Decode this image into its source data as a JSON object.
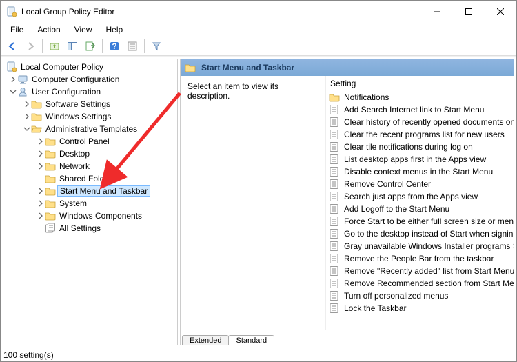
{
  "window": {
    "title": "Local Group Policy Editor"
  },
  "menu": {
    "file": "File",
    "action": "Action",
    "view": "View",
    "help": "Help"
  },
  "tree": {
    "root": "Local Computer Policy",
    "cc": "Computer Configuration",
    "uc": "User Configuration",
    "ss": "Software Settings",
    "ws": "Windows Settings",
    "at": "Administrative Templates",
    "cp": "Control Panel",
    "dk": "Desktop",
    "nw": "Network",
    "sf": "Shared Folders",
    "sm": "Start Menu and Taskbar",
    "sy": "System",
    "wc": "Windows Components",
    "as": "All Settings"
  },
  "detail": {
    "header": "Start Menu and Taskbar",
    "desc": "Select an item to view its description.",
    "col": "Setting",
    "items": [
      "Notifications",
      "Add Search Internet link to Start Menu",
      "Clear history of recently opened documents on",
      "Clear the recent programs list for new users",
      "Clear tile notifications during log on",
      "List desktop apps first in the Apps view",
      "Disable context menus in the Start Menu",
      "Remove Control Center",
      "Search just apps from the Apps view",
      "Add Logoff to the Start Menu",
      "Force Start to be either full screen size or menu s",
      "Go to the desktop instead of Start when signing",
      "Gray unavailable Windows Installer programs Sta",
      "Remove the People Bar from the taskbar",
      "Remove \"Recently added\" list from Start Menu",
      "Remove Recommended section from Start Men",
      "Turn off personalized menus",
      "Lock the Taskbar"
    ]
  },
  "tabs": {
    "extended": "Extended",
    "standard": "Standard"
  },
  "status": {
    "count": "100 setting(s)"
  }
}
